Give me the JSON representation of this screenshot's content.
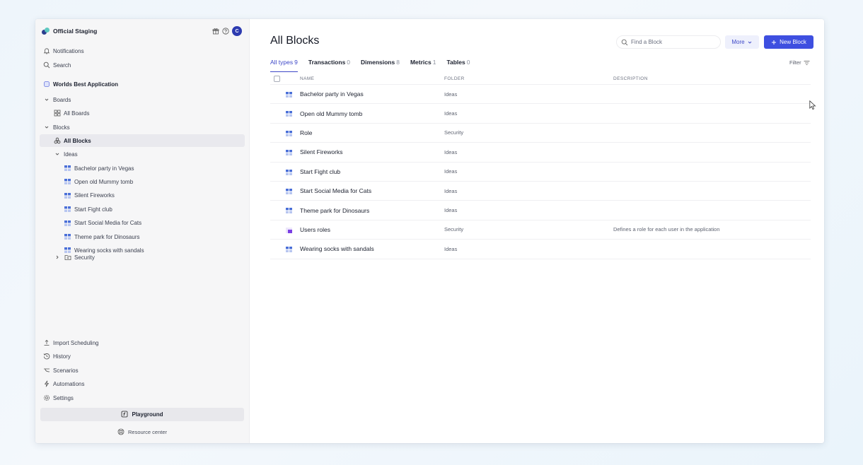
{
  "workspace": {
    "name": "Official Staging",
    "avatar_letter": "C"
  },
  "sidebar": {
    "notifications": "Notifications",
    "search": "Search",
    "app_name": "Worlds Best Application",
    "boards": {
      "label": "Boards",
      "all_boards": "All Boards"
    },
    "blocks": {
      "label": "Blocks",
      "all_blocks": "All Blocks",
      "ideas_folder": "Ideas",
      "ideas_items": [
        "Bachelor party in Vegas",
        "Open old Mummy tomb",
        "Silent Fireworks",
        "Start Fight club",
        "Start Social Media for Cats",
        "Theme park for Dinosaurs",
        "Wearing socks with sandals"
      ],
      "security_folder": "Security"
    },
    "bottom": {
      "import": "Import Scheduling",
      "history": "History",
      "scenarios": "Scenarios",
      "automations": "Automations",
      "settings": "Settings"
    },
    "playground": "Playground",
    "resource_center": "Resource center"
  },
  "main": {
    "title": "All Blocks",
    "search_placeholder": "Find a Block",
    "more_label": "More",
    "new_block_label": "New Block",
    "filter_label": "Filter",
    "tabs": [
      {
        "label": "All types",
        "count": "9"
      },
      {
        "label": "Transactions",
        "count": "0"
      },
      {
        "label": "Dimensions",
        "count": "8"
      },
      {
        "label": "Metrics",
        "count": "1"
      },
      {
        "label": "Tables",
        "count": "0"
      }
    ],
    "columns": {
      "name": "NAME",
      "folder": "FOLDER",
      "description": "DESCRIPTION"
    },
    "rows": [
      {
        "name": "Bachelor party in Vegas",
        "folder": "Ideas",
        "description": "",
        "type": "dimension"
      },
      {
        "name": "Open old Mummy tomb",
        "folder": "Ideas",
        "description": "",
        "type": "dimension"
      },
      {
        "name": "Role",
        "folder": "Security",
        "description": "",
        "type": "dimension"
      },
      {
        "name": "Silent Fireworks",
        "folder": "Ideas",
        "description": "",
        "type": "dimension"
      },
      {
        "name": "Start Fight club",
        "folder": "Ideas",
        "description": "",
        "type": "dimension"
      },
      {
        "name": "Start Social Media for Cats",
        "folder": "Ideas",
        "description": "",
        "type": "dimension"
      },
      {
        "name": "Theme park for Dinosaurs",
        "folder": "Ideas",
        "description": "",
        "type": "dimension"
      },
      {
        "name": "Users roles",
        "folder": "Security",
        "description": "Defines a role for each user in the application",
        "type": "metric"
      },
      {
        "name": "Wearing socks with sandals",
        "folder": "Ideas",
        "description": "",
        "type": "dimension"
      }
    ]
  },
  "colors": {
    "accent": "#3e4fe0",
    "metric_icon": "#7b3fe4",
    "dimension_icon": "#4a6fd8"
  }
}
